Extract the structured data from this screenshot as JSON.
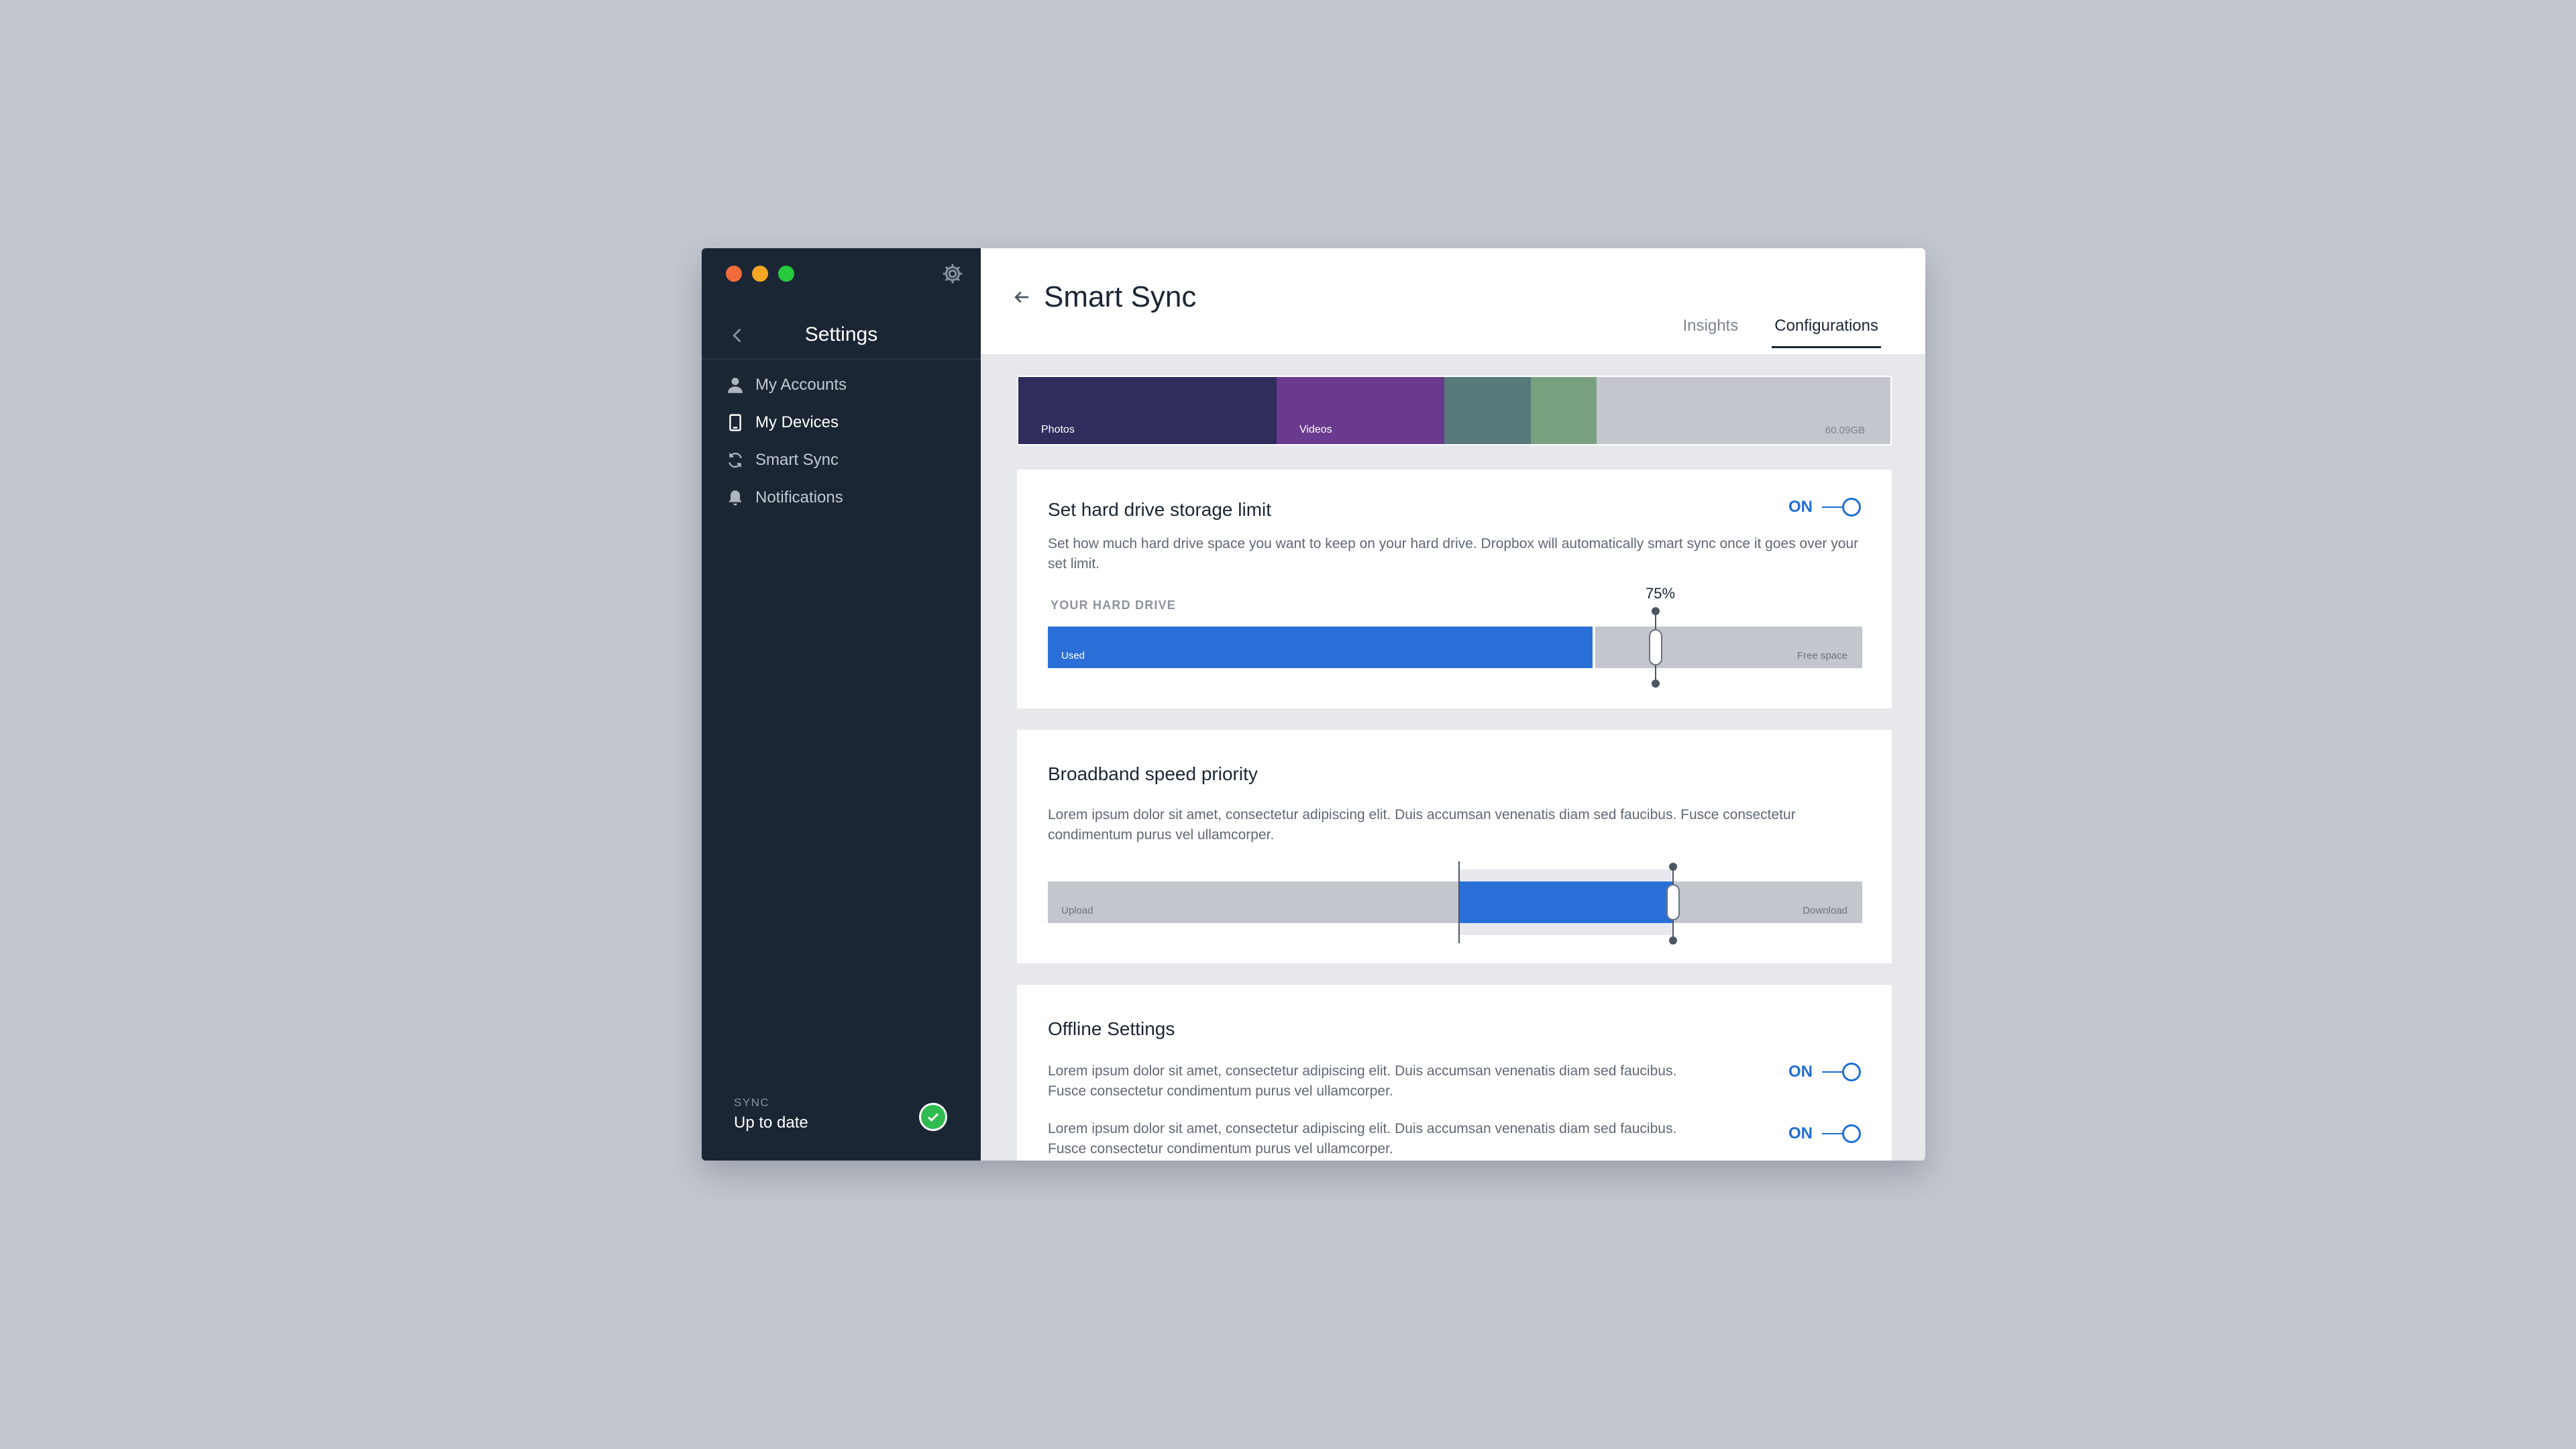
{
  "sidebar": {
    "title": "Settings",
    "items": [
      {
        "label": "My Accounts",
        "icon": "user-icon"
      },
      {
        "label": "My Devices",
        "icon": "device-icon",
        "active": true
      },
      {
        "label": "Smart Sync",
        "icon": "sync-icon"
      },
      {
        "label": "Notifications",
        "icon": "bell-icon"
      }
    ],
    "sync_label": "SYNC",
    "sync_status": "Up to date"
  },
  "main": {
    "title": "Smart Sync",
    "tabs": [
      {
        "label": "Insights"
      },
      {
        "label": "Configurations",
        "active": true
      }
    ],
    "storage": {
      "segments": [
        {
          "label": "Photos",
          "color": "#2e2d5c"
        },
        {
          "label": "Videos",
          "color": "#6a3a8e"
        },
        {
          "label": "",
          "color": "#57797a"
        },
        {
          "label": "",
          "color": "#7aa17f"
        }
      ],
      "free_size": "60.09GB"
    },
    "hard_drive": {
      "title": "Set hard drive storage limit",
      "toggle": "ON",
      "description": "Set how much hard drive space you want to keep on your hard drive. Dropbox will automatically smart sync once it goes over your set limit.",
      "section_label": "YOUR HARD DRIVE",
      "limit_percent": "75%",
      "used_label": "Used",
      "free_label": "Free space"
    },
    "broadband": {
      "title": "Broadband speed priority",
      "description": "Lorem ipsum dolor sit amet, consectetur adipiscing elit. Duis accumsan venenatis diam sed faucibus. Fusce consectetur condimentum purus vel ullamcorper.",
      "upload_label": "Upload",
      "download_label": "Download"
    },
    "offline": {
      "title": "Offline Settings",
      "rows": [
        {
          "text": "Lorem ipsum dolor sit amet, consectetur adipiscing elit. Duis accumsan venenatis diam sed faucibus. Fusce consectetur condimentum purus vel ullamcorper.",
          "toggle": "ON"
        },
        {
          "text": "Lorem ipsum dolor sit amet, consectetur adipiscing elit. Duis accumsan venenatis diam sed faucibus. Fusce consectetur condimentum purus vel ullamcorper.",
          "toggle": "ON"
        }
      ]
    }
  },
  "colors": {
    "sidebar_bg": "#1b2634",
    "accent_blue": "#2a6fd8",
    "toggle_blue": "#1f6ed4",
    "sync_green": "#2fbb4f"
  }
}
